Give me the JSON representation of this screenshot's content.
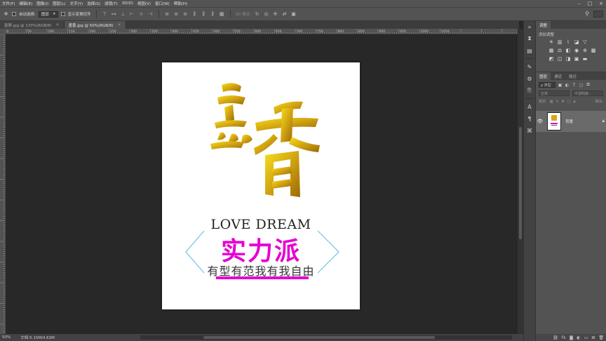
{
  "menu": [
    "文件(F)",
    "编辑(E)",
    "图像(I)",
    "图层(L)",
    "文字(Y)",
    "选择(S)",
    "滤镜(T)",
    "3D(D)",
    "视图(V)",
    "窗口(W)",
    "帮助(H)"
  ],
  "options": {
    "auto_select_label": "自动选择:",
    "auto_select_value": "图层",
    "show_transform_label": "显示变换控件",
    "mode_3d_label": "3D 模式:"
  },
  "tabs": [
    {
      "label": "墨屏.jpg @ 133%(RGB/8)",
      "close": "×"
    },
    {
      "label": "墨香.jpg @ 50%(RGB/8)",
      "close": "×"
    }
  ],
  "ruler_ticks": [
    "0",
    "50",
    "100",
    "150",
    "200",
    "250",
    "300",
    "350",
    "400",
    "450",
    "500",
    "550",
    "600",
    "650",
    "700",
    "750",
    "800",
    "850",
    "900",
    "950",
    "1000",
    "1050"
  ],
  "artwork": {
    "headline_en": "LOVE DREAM",
    "slogan_main": "实力派",
    "slogan_sub": "有型有范我有我自由",
    "gold_color": "#c79a10",
    "magenta_color": "#e600d2",
    "bracket_color": "#6fc3e8"
  },
  "status": {
    "zoom": "50%",
    "doc_info": "文档:5.15M/4.63M"
  },
  "panels": {
    "top_tabs": [
      "调整"
    ],
    "adjust_title": "添加调整",
    "layers_tabs": [
      "图层",
      "通道",
      "路径"
    ],
    "filter_kind": "ρ 类型",
    "blend_mode": "正常",
    "opacity_label": "不透明度:",
    "lock_label": "锁定:",
    "fill_label": "填充:",
    "layer_name": "背景"
  }
}
